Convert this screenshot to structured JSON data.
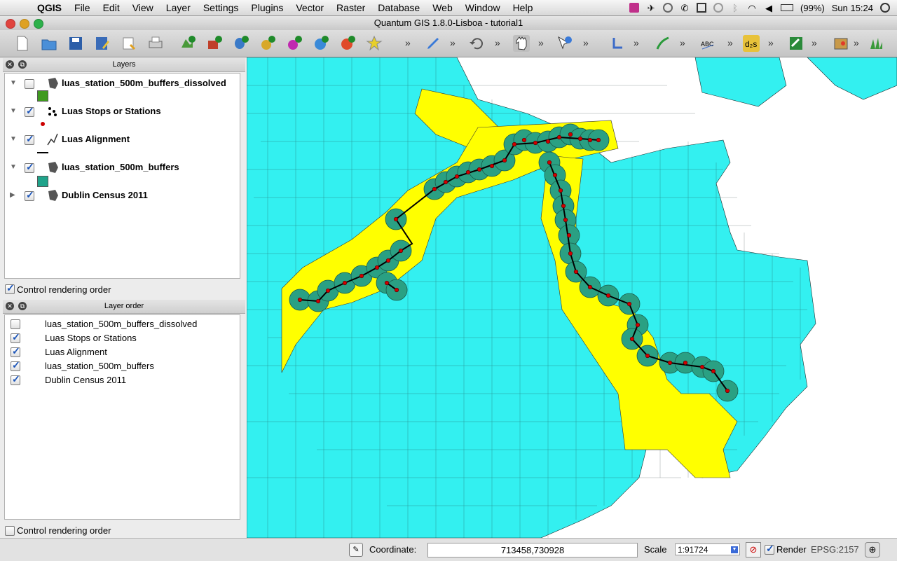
{
  "menubar": {
    "app": "QGIS",
    "items": [
      "File",
      "Edit",
      "View",
      "Layer",
      "Settings",
      "Plugins",
      "Vector",
      "Raster",
      "Database",
      "Web",
      "Window",
      "Help"
    ],
    "battery": "(99%)",
    "clock": "Sun 15:24"
  },
  "window": {
    "title": "Quantum GIS 1.8.0-Lisboa - tutorial1"
  },
  "layers_panel": {
    "title": "Layers",
    "layers": [
      {
        "name": "luas_station_500m_buffers_dissolved",
        "checked": false,
        "symbol_color": "#3f9a1f"
      },
      {
        "name": "Luas Stops or Stations",
        "checked": true,
        "symbol_color": "#cc0000"
      },
      {
        "name": "Luas Alignment",
        "checked": true,
        "symbol_color": "#000000"
      },
      {
        "name": "luas_station_500m_buffers",
        "checked": true,
        "symbol_color": "#1fa38a"
      },
      {
        "name": "Dublin Census 2011",
        "checked": true,
        "symbol_color": ""
      }
    ],
    "control_rendering_order": "Control rendering order"
  },
  "order_panel": {
    "title": "Layer order",
    "items": [
      {
        "name": "luas_station_500m_buffers_dissolved",
        "checked": false
      },
      {
        "name": "Luas Stops or Stations",
        "checked": true
      },
      {
        "name": "Luas Alignment",
        "checked": true
      },
      {
        "name": "luas_station_500m_buffers",
        "checked": true
      },
      {
        "name": "Dublin Census 2011",
        "checked": true
      }
    ],
    "control_rendering_order": "Control rendering order"
  },
  "statusbar": {
    "coordinate_label": "Coordinate:",
    "coordinate_value": "713458,730928",
    "scale_label": "Scale",
    "scale_value": "1:91724",
    "render_label": "Render",
    "crs": "EPSG:2157"
  },
  "map_colors": {
    "census": "#33f0f0",
    "dissolved": "#ffff00",
    "buffer": "#2aa083",
    "stop": "#d00000"
  }
}
